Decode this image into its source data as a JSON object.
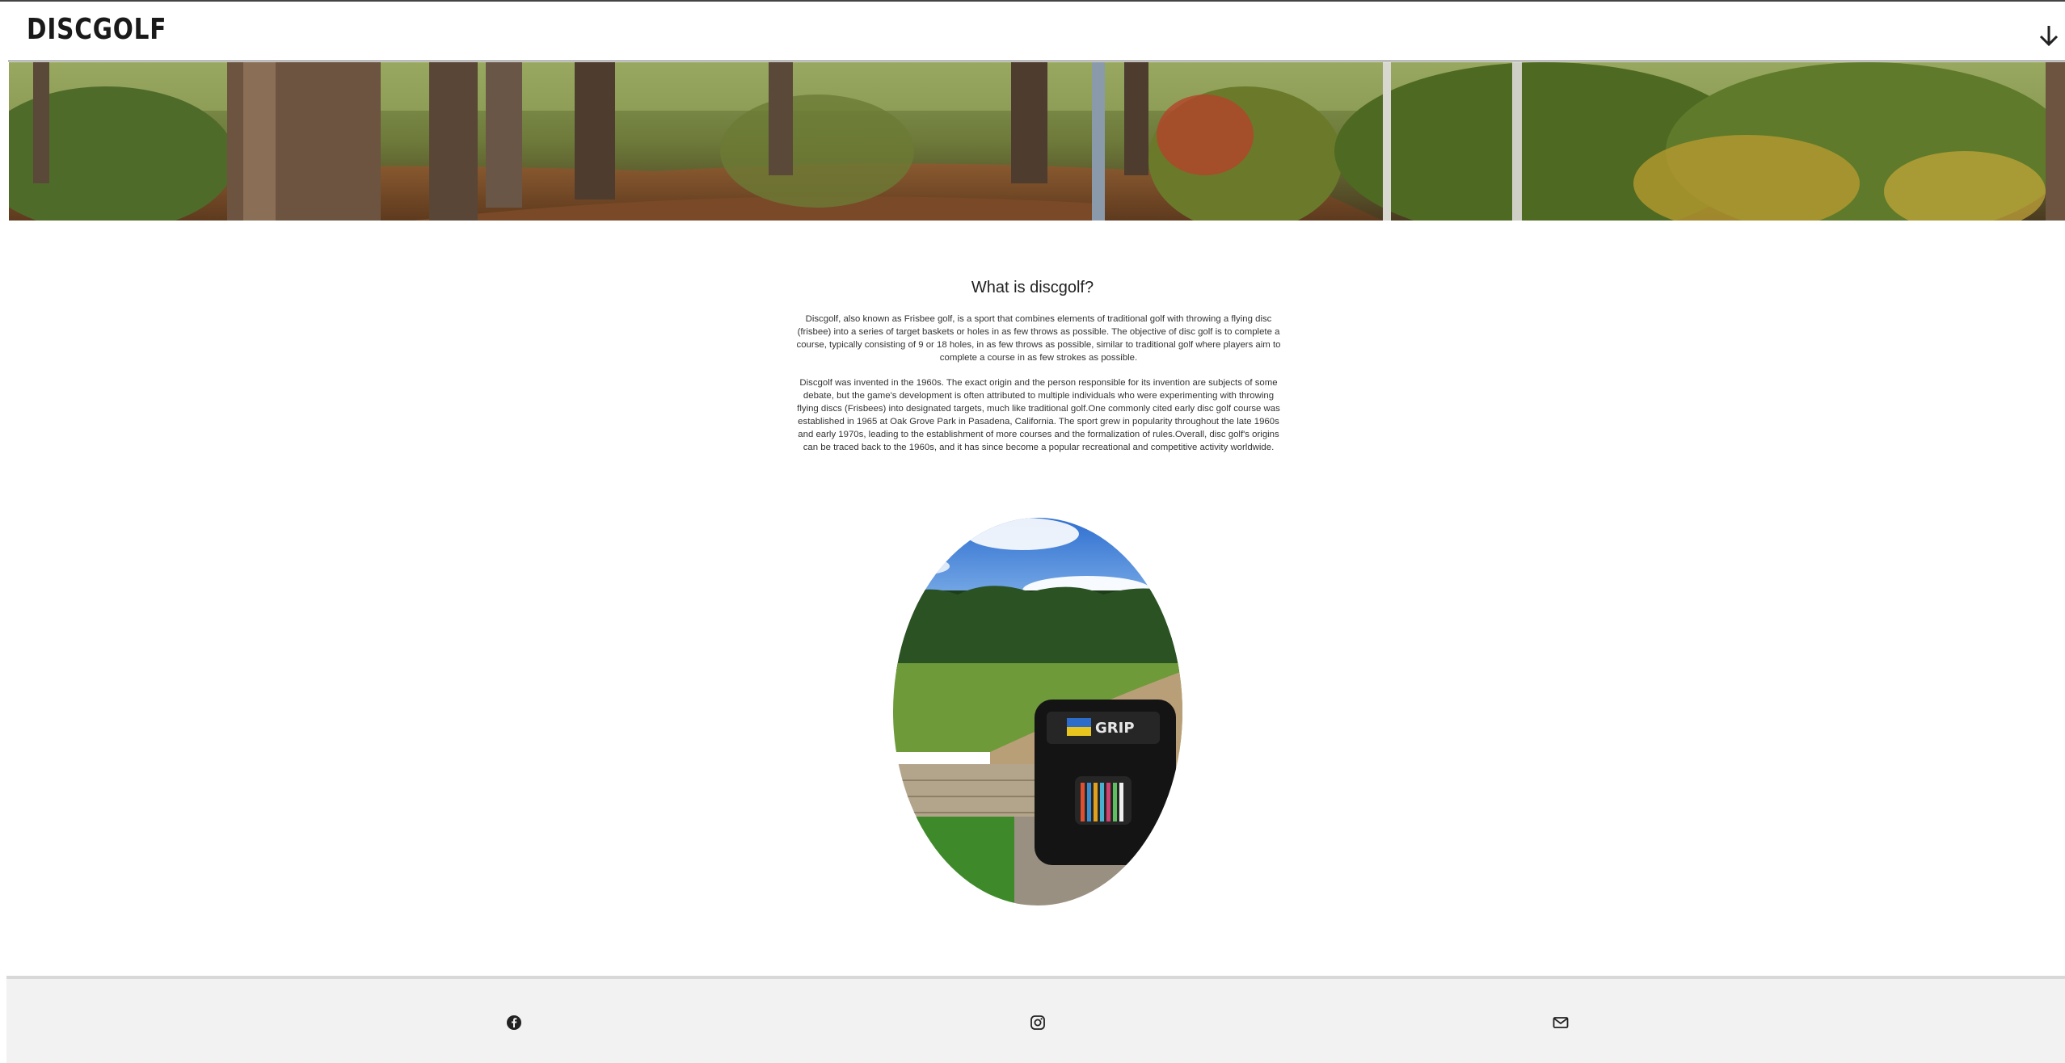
{
  "header": {
    "logo": "DISCGOLF",
    "scroll_icon": "arrow-down-icon"
  },
  "hero": {
    "image": "forest-disc-golf-course-banner"
  },
  "main": {
    "title": "What is discgolf?",
    "paragraph1": "Discgolf, also known as Frisbee golf, is a sport that combines elements of traditional golf with throwing a flying disc (frisbee) into a series of target baskets or holes in as few throws as possible. The objective of disc golf is to complete a course, typically consisting of 9 or 18 holes, in as few throws as possible, similar to traditional golf where players aim to complete a course in as few strokes as possible.",
    "paragraph2": "Discgolf was invented in the 1960s. The exact origin and the person responsible for its invention are subjects of some debate, but the game's development is often attributed to multiple individuals who were experimenting with throwing flying discs (Frisbees) into designated targets, much like traditional golf.One commonly cited early disc golf course was established in 1965 at Oak Grove Park in Pasadena, California. The sport grew in popularity throughout the late 1960s and early 1970s, leading to the establishment of more courses and the formalization of rules.Overall, disc golf's origins can be traced back to the 1960s, and it has since become a popular recreational and competitive activity worldwide.",
    "image": "disc-golf-bag-on-tee-pad-photo"
  },
  "footer": {
    "icons": [
      "facebook-icon",
      "instagram-icon",
      "mail-icon"
    ]
  },
  "colors": {
    "footer_bg": "#f2f2f2",
    "text": "#222222"
  }
}
